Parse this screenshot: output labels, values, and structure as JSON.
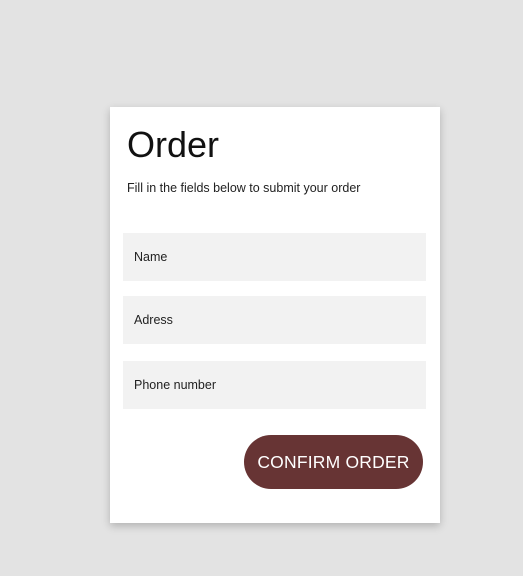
{
  "form": {
    "title": "Order",
    "subtitle": "Fill in the fields below to submit your order",
    "fields": [
      {
        "placeholder": "Name",
        "value": ""
      },
      {
        "placeholder": "Adress",
        "value": ""
      },
      {
        "placeholder": "Phone number",
        "value": ""
      }
    ],
    "submit_label": "CONFIRM ORDER"
  },
  "colors": {
    "page_background": "#e3e3e3",
    "card_background": "#ffffff",
    "field_background": "#f2f2f2",
    "button_background": "#673434",
    "button_text": "#ffffff"
  }
}
